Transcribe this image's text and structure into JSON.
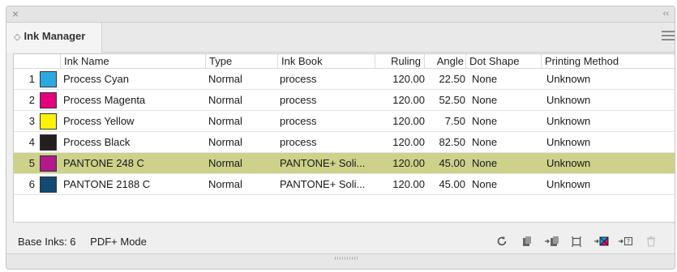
{
  "titlebar": {
    "close_glyph": "×",
    "collapse_glyph": "‹‹"
  },
  "tab": {
    "arrows_glyph": "◇",
    "label": "Ink Manager"
  },
  "table": {
    "columns": [
      "Ink Name",
      "Type",
      "Ink Book",
      "Ruling",
      "Angle",
      "Dot Shape",
      "Printing Method"
    ],
    "rows": [
      {
        "num": "1",
        "swatch": "#2aaae2",
        "name": "Process Cyan",
        "type": "Normal",
        "book": "process",
        "ruling": "120.00",
        "angle": "22.50",
        "dot": "None",
        "method": "Unknown",
        "selected": false
      },
      {
        "num": "2",
        "swatch": "#e6007e",
        "name": "Process Magenta",
        "type": "Normal",
        "book": "process",
        "ruling": "120.00",
        "angle": "52.50",
        "dot": "None",
        "method": "Unknown",
        "selected": false
      },
      {
        "num": "3",
        "swatch": "#fff200",
        "name": "Process Yellow",
        "type": "Normal",
        "book": "process",
        "ruling": "120.00",
        "angle": "7.50",
        "dot": "None",
        "method": "Unknown",
        "selected": false
      },
      {
        "num": "4",
        "swatch": "#231f20",
        "name": "Process Black",
        "type": "Normal",
        "book": "process",
        "ruling": "120.00",
        "angle": "82.50",
        "dot": "None",
        "method": "Unknown",
        "selected": false
      },
      {
        "num": "5",
        "swatch": "#b5188a",
        "name": "PANTONE 248 C",
        "type": "Normal",
        "book": "PANTONE+ Soli...",
        "ruling": "120.00",
        "angle": "45.00",
        "dot": "None",
        "method": "Unknown",
        "selected": true
      },
      {
        "num": "6",
        "swatch": "#124a74",
        "name": "PANTONE 2188 C",
        "type": "Normal",
        "book": "PANTONE+ Soli...",
        "ruling": "120.00",
        "angle": "45.00",
        "dot": "None",
        "method": "Unknown",
        "selected": false
      }
    ]
  },
  "footer": {
    "base_inks": "Base Inks: 6",
    "mode": "PDF+ Mode",
    "tool_icons": [
      "refresh-icon",
      "copy-ink-icon",
      "move-ink-icon",
      "frame-icon",
      "map-ink-icon",
      "query-ink-icon",
      "trash-icon"
    ]
  },
  "colors": {
    "selected_row": "#cdd189",
    "panel_bg": "#efefef"
  }
}
